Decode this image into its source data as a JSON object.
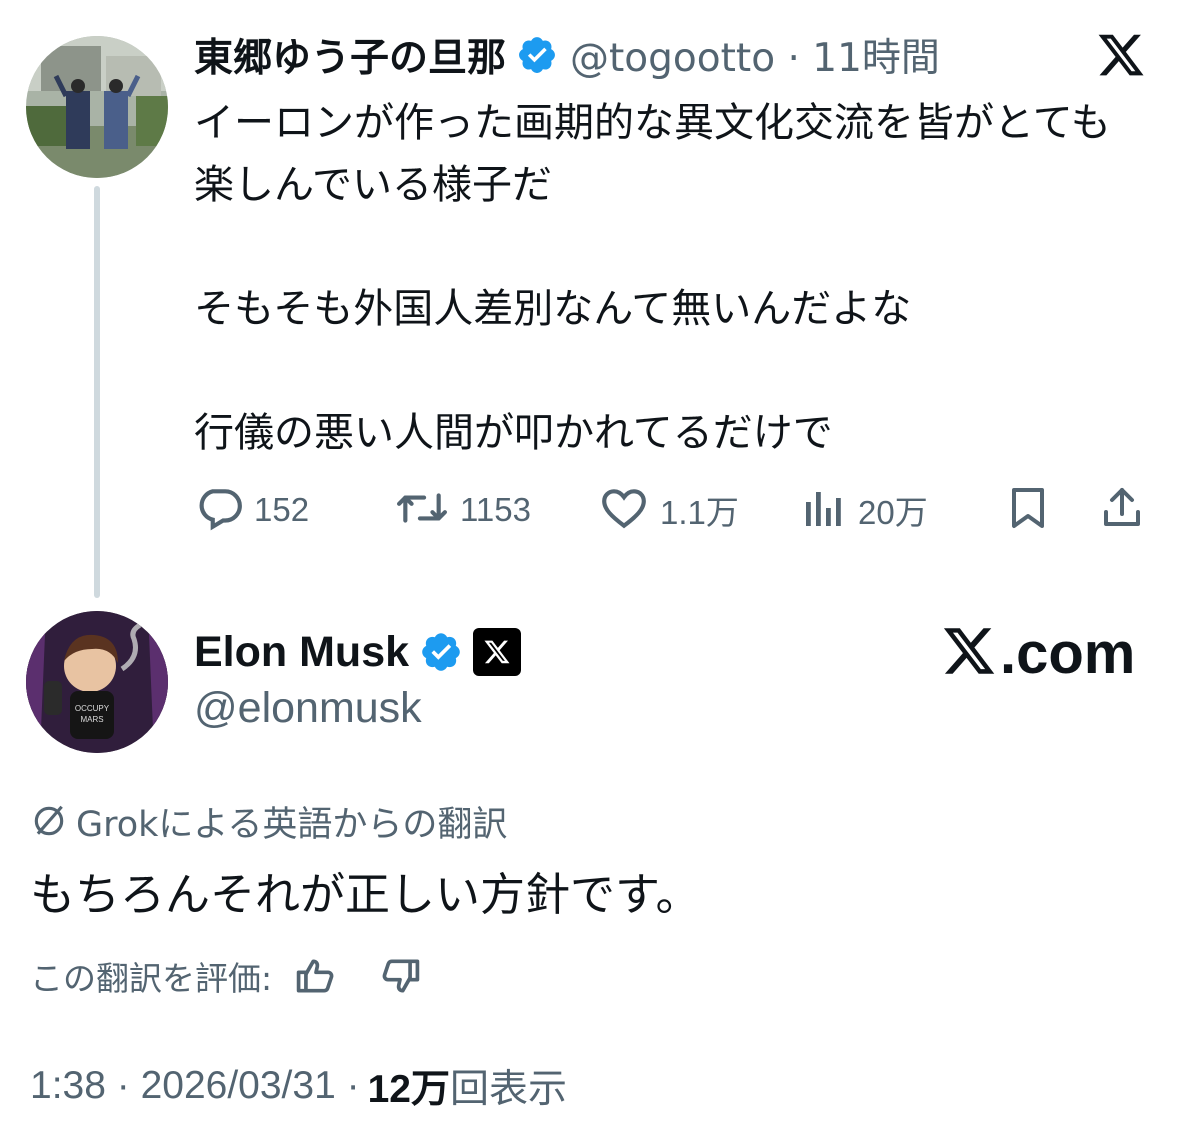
{
  "parent_tweet": {
    "author_name": "東郷ゆう子の旦那",
    "handle_time": "@togootto · 11時間",
    "text": "イーロンが作った画期的な異文化交流を皆がとても楽しんでいる様子だ\n\nそもそも外国人差別なんて無いんだよな\n\n行儀の悪い人間が叩かれてるだけで",
    "replies": "152",
    "reposts": "1153",
    "likes": "1.1万",
    "views": "20万",
    "accent_color": "#1d9bf0"
  },
  "reply_tweet": {
    "author_name": "Elon Musk",
    "handle": "@elonmusk",
    "site_label": ".com",
    "translation_note": "Grokによる英語からの翻訳",
    "translated_text": "もちろんそれが正しい方針です。",
    "rate_label": "この翻訳を評価:",
    "timestamp": "1:38 · 2026/03/31 ·",
    "views_count": "12万",
    "views_label": "回表示"
  },
  "icons": [
    "x-logo-icon",
    "verified-badge-icon",
    "reply-icon",
    "repost-icon",
    "like-icon",
    "views-icon",
    "bookmark-icon",
    "share-icon",
    "translate-icon",
    "thumbs-up-icon",
    "thumbs-down-icon"
  ]
}
